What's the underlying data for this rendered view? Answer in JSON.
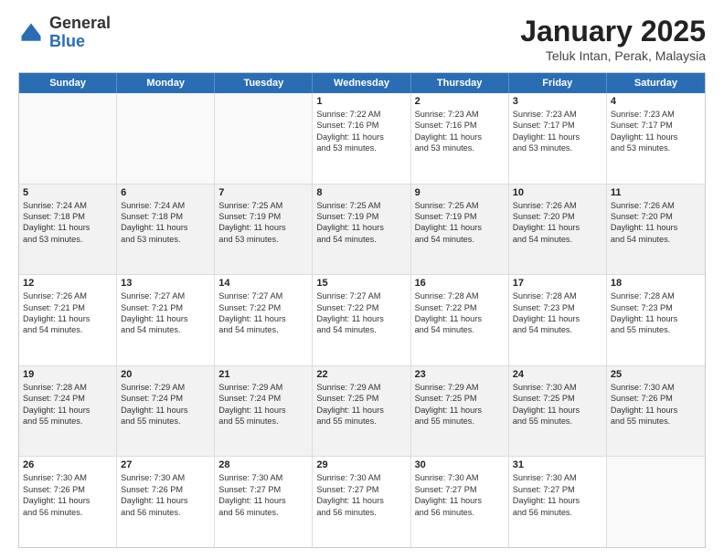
{
  "header": {
    "logo_general": "General",
    "logo_blue": "Blue",
    "title": "January 2025",
    "subtitle": "Teluk Intan, Perak, Malaysia"
  },
  "weekdays": [
    "Sunday",
    "Monday",
    "Tuesday",
    "Wednesday",
    "Thursday",
    "Friday",
    "Saturday"
  ],
  "weeks": [
    [
      {
        "day": "",
        "lines": []
      },
      {
        "day": "",
        "lines": []
      },
      {
        "day": "",
        "lines": []
      },
      {
        "day": "1",
        "lines": [
          "Sunrise: 7:22 AM",
          "Sunset: 7:16 PM",
          "Daylight: 11 hours",
          "and 53 minutes."
        ]
      },
      {
        "day": "2",
        "lines": [
          "Sunrise: 7:23 AM",
          "Sunset: 7:16 PM",
          "Daylight: 11 hours",
          "and 53 minutes."
        ]
      },
      {
        "day": "3",
        "lines": [
          "Sunrise: 7:23 AM",
          "Sunset: 7:17 PM",
          "Daylight: 11 hours",
          "and 53 minutes."
        ]
      },
      {
        "day": "4",
        "lines": [
          "Sunrise: 7:23 AM",
          "Sunset: 7:17 PM",
          "Daylight: 11 hours",
          "and 53 minutes."
        ]
      }
    ],
    [
      {
        "day": "5",
        "lines": [
          "Sunrise: 7:24 AM",
          "Sunset: 7:18 PM",
          "Daylight: 11 hours",
          "and 53 minutes."
        ]
      },
      {
        "day": "6",
        "lines": [
          "Sunrise: 7:24 AM",
          "Sunset: 7:18 PM",
          "Daylight: 11 hours",
          "and 53 minutes."
        ]
      },
      {
        "day": "7",
        "lines": [
          "Sunrise: 7:25 AM",
          "Sunset: 7:19 PM",
          "Daylight: 11 hours",
          "and 53 minutes."
        ]
      },
      {
        "day": "8",
        "lines": [
          "Sunrise: 7:25 AM",
          "Sunset: 7:19 PM",
          "Daylight: 11 hours",
          "and 54 minutes."
        ]
      },
      {
        "day": "9",
        "lines": [
          "Sunrise: 7:25 AM",
          "Sunset: 7:19 PM",
          "Daylight: 11 hours",
          "and 54 minutes."
        ]
      },
      {
        "day": "10",
        "lines": [
          "Sunrise: 7:26 AM",
          "Sunset: 7:20 PM",
          "Daylight: 11 hours",
          "and 54 minutes."
        ]
      },
      {
        "day": "11",
        "lines": [
          "Sunrise: 7:26 AM",
          "Sunset: 7:20 PM",
          "Daylight: 11 hours",
          "and 54 minutes."
        ]
      }
    ],
    [
      {
        "day": "12",
        "lines": [
          "Sunrise: 7:26 AM",
          "Sunset: 7:21 PM",
          "Daylight: 11 hours",
          "and 54 minutes."
        ]
      },
      {
        "day": "13",
        "lines": [
          "Sunrise: 7:27 AM",
          "Sunset: 7:21 PM",
          "Daylight: 11 hours",
          "and 54 minutes."
        ]
      },
      {
        "day": "14",
        "lines": [
          "Sunrise: 7:27 AM",
          "Sunset: 7:22 PM",
          "Daylight: 11 hours",
          "and 54 minutes."
        ]
      },
      {
        "day": "15",
        "lines": [
          "Sunrise: 7:27 AM",
          "Sunset: 7:22 PM",
          "Daylight: 11 hours",
          "and 54 minutes."
        ]
      },
      {
        "day": "16",
        "lines": [
          "Sunrise: 7:28 AM",
          "Sunset: 7:22 PM",
          "Daylight: 11 hours",
          "and 54 minutes."
        ]
      },
      {
        "day": "17",
        "lines": [
          "Sunrise: 7:28 AM",
          "Sunset: 7:23 PM",
          "Daylight: 11 hours",
          "and 54 minutes."
        ]
      },
      {
        "day": "18",
        "lines": [
          "Sunrise: 7:28 AM",
          "Sunset: 7:23 PM",
          "Daylight: 11 hours",
          "and 55 minutes."
        ]
      }
    ],
    [
      {
        "day": "19",
        "lines": [
          "Sunrise: 7:28 AM",
          "Sunset: 7:24 PM",
          "Daylight: 11 hours",
          "and 55 minutes."
        ]
      },
      {
        "day": "20",
        "lines": [
          "Sunrise: 7:29 AM",
          "Sunset: 7:24 PM",
          "Daylight: 11 hours",
          "and 55 minutes."
        ]
      },
      {
        "day": "21",
        "lines": [
          "Sunrise: 7:29 AM",
          "Sunset: 7:24 PM",
          "Daylight: 11 hours",
          "and 55 minutes."
        ]
      },
      {
        "day": "22",
        "lines": [
          "Sunrise: 7:29 AM",
          "Sunset: 7:25 PM",
          "Daylight: 11 hours",
          "and 55 minutes."
        ]
      },
      {
        "day": "23",
        "lines": [
          "Sunrise: 7:29 AM",
          "Sunset: 7:25 PM",
          "Daylight: 11 hours",
          "and 55 minutes."
        ]
      },
      {
        "day": "24",
        "lines": [
          "Sunrise: 7:30 AM",
          "Sunset: 7:25 PM",
          "Daylight: 11 hours",
          "and 55 minutes."
        ]
      },
      {
        "day": "25",
        "lines": [
          "Sunrise: 7:30 AM",
          "Sunset: 7:26 PM",
          "Daylight: 11 hours",
          "and 55 minutes."
        ]
      }
    ],
    [
      {
        "day": "26",
        "lines": [
          "Sunrise: 7:30 AM",
          "Sunset: 7:26 PM",
          "Daylight: 11 hours",
          "and 56 minutes."
        ]
      },
      {
        "day": "27",
        "lines": [
          "Sunrise: 7:30 AM",
          "Sunset: 7:26 PM",
          "Daylight: 11 hours",
          "and 56 minutes."
        ]
      },
      {
        "day": "28",
        "lines": [
          "Sunrise: 7:30 AM",
          "Sunset: 7:27 PM",
          "Daylight: 11 hours",
          "and 56 minutes."
        ]
      },
      {
        "day": "29",
        "lines": [
          "Sunrise: 7:30 AM",
          "Sunset: 7:27 PM",
          "Daylight: 11 hours",
          "and 56 minutes."
        ]
      },
      {
        "day": "30",
        "lines": [
          "Sunrise: 7:30 AM",
          "Sunset: 7:27 PM",
          "Daylight: 11 hours",
          "and 56 minutes."
        ]
      },
      {
        "day": "31",
        "lines": [
          "Sunrise: 7:30 AM",
          "Sunset: 7:27 PM",
          "Daylight: 11 hours",
          "and 56 minutes."
        ]
      },
      {
        "day": "",
        "lines": []
      }
    ]
  ],
  "colors": {
    "header_bg": "#2a6db5",
    "alt_row_bg": "#f2f2f2",
    "empty_bg": "#f9f9f9"
  }
}
